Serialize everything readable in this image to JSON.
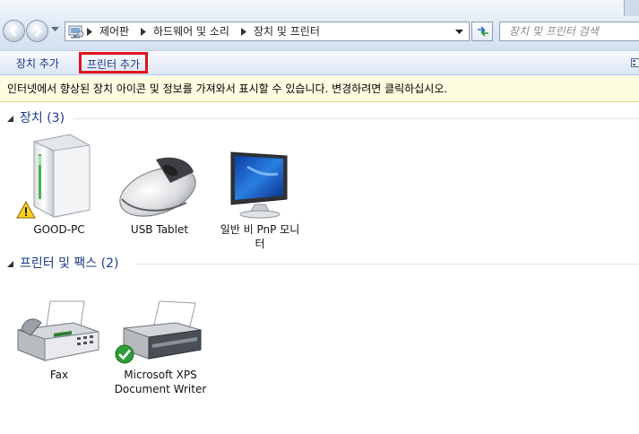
{
  "window": {
    "breadcrumb": [
      "제어판",
      "하드웨어 및 소리",
      "장치 및 프린터"
    ],
    "search_placeholder": "장치 및 프린터 검색"
  },
  "toolbar": {
    "add_device": "장치 추가",
    "add_printer": "프린터 추가"
  },
  "infobar": {
    "message": "인터넷에서 향상된 장치 아이콘 및 정보를 가져와서 표시할 수 있습니다. 변경하려면 클릭하십시오."
  },
  "groups": {
    "devices": {
      "title": "장치 (3)",
      "items": [
        {
          "label": "GOOD-PC",
          "icon": "computer-icon",
          "badge": "warning"
        },
        {
          "label": "USB Tablet",
          "icon": "mouse-icon"
        },
        {
          "label_lines": [
            "일반 비 PnP 모니",
            "터"
          ],
          "icon": "monitor-icon"
        }
      ]
    },
    "printers": {
      "title": "프린터 및 팩스 (2)",
      "items": [
        {
          "label": "Fax",
          "icon": "fax-icon"
        },
        {
          "label_lines": [
            "Microsoft XPS",
            "Document Writer"
          ],
          "icon": "printer-icon",
          "badge": "default-check"
        }
      ]
    }
  },
  "colors": {
    "highlight_border": "#e0141d",
    "infobar_bg": "#fffde1",
    "group_title": "#1e3a8a",
    "command_text": "#1e3287"
  }
}
